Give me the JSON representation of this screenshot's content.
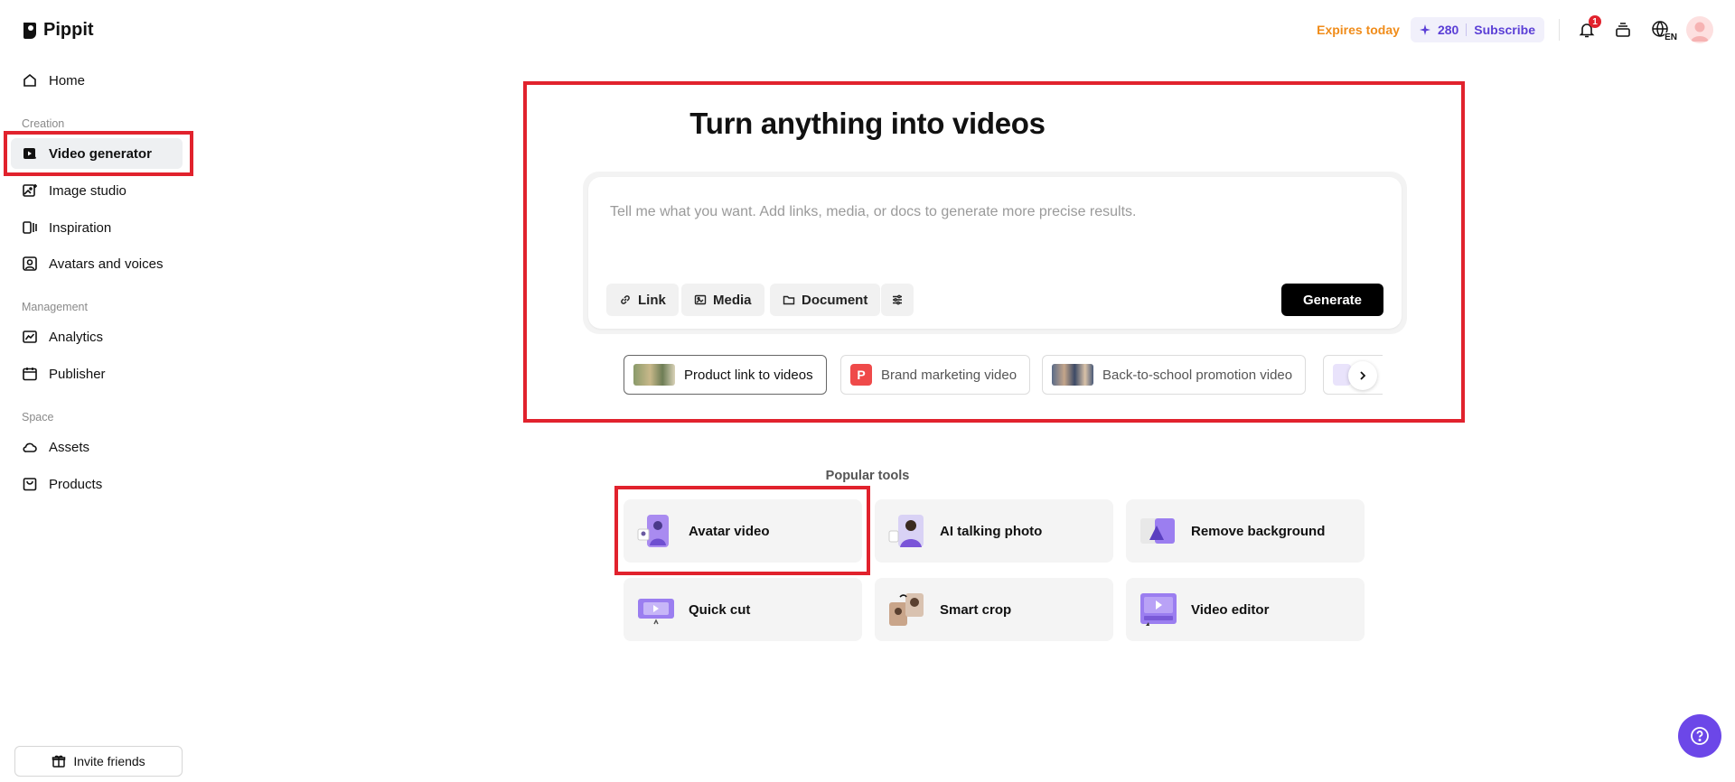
{
  "app": {
    "name": "Pippit"
  },
  "sidebar": {
    "home": "Home",
    "sections": {
      "creation": "Creation",
      "management": "Management",
      "space": "Space"
    },
    "creation_items": [
      "Video generator",
      "Image studio",
      "Inspiration",
      "Avatars and voices"
    ],
    "management_items": [
      "Analytics",
      "Publisher"
    ],
    "space_items": [
      "Assets",
      "Products"
    ],
    "invite_label": "Invite friends"
  },
  "topbar": {
    "expires": "Expires today",
    "credits": "280",
    "subscribe": "Subscribe",
    "notification_count": "1",
    "language": "EN"
  },
  "hero": {
    "title": "Turn anything into videos",
    "placeholder": "Tell me what you want. Add links, media, or docs to generate more precise results.",
    "chips": [
      "Link",
      "Media",
      "Document"
    ],
    "generate_label": "Generate",
    "templates": [
      "Product link to videos",
      "Brand marketing video",
      "Back-to-school promotion video"
    ],
    "template_p_letter": "P"
  },
  "popular": {
    "title": "Popular tools",
    "tools": [
      "Avatar video",
      "AI talking photo",
      "Remove background",
      "Quick cut",
      "Smart crop",
      "Video editor"
    ]
  },
  "colors": {
    "accent": "#5b3fd6",
    "highlight": "#e1222d",
    "expires": "#f08c1a",
    "help": "#6c47e8"
  }
}
